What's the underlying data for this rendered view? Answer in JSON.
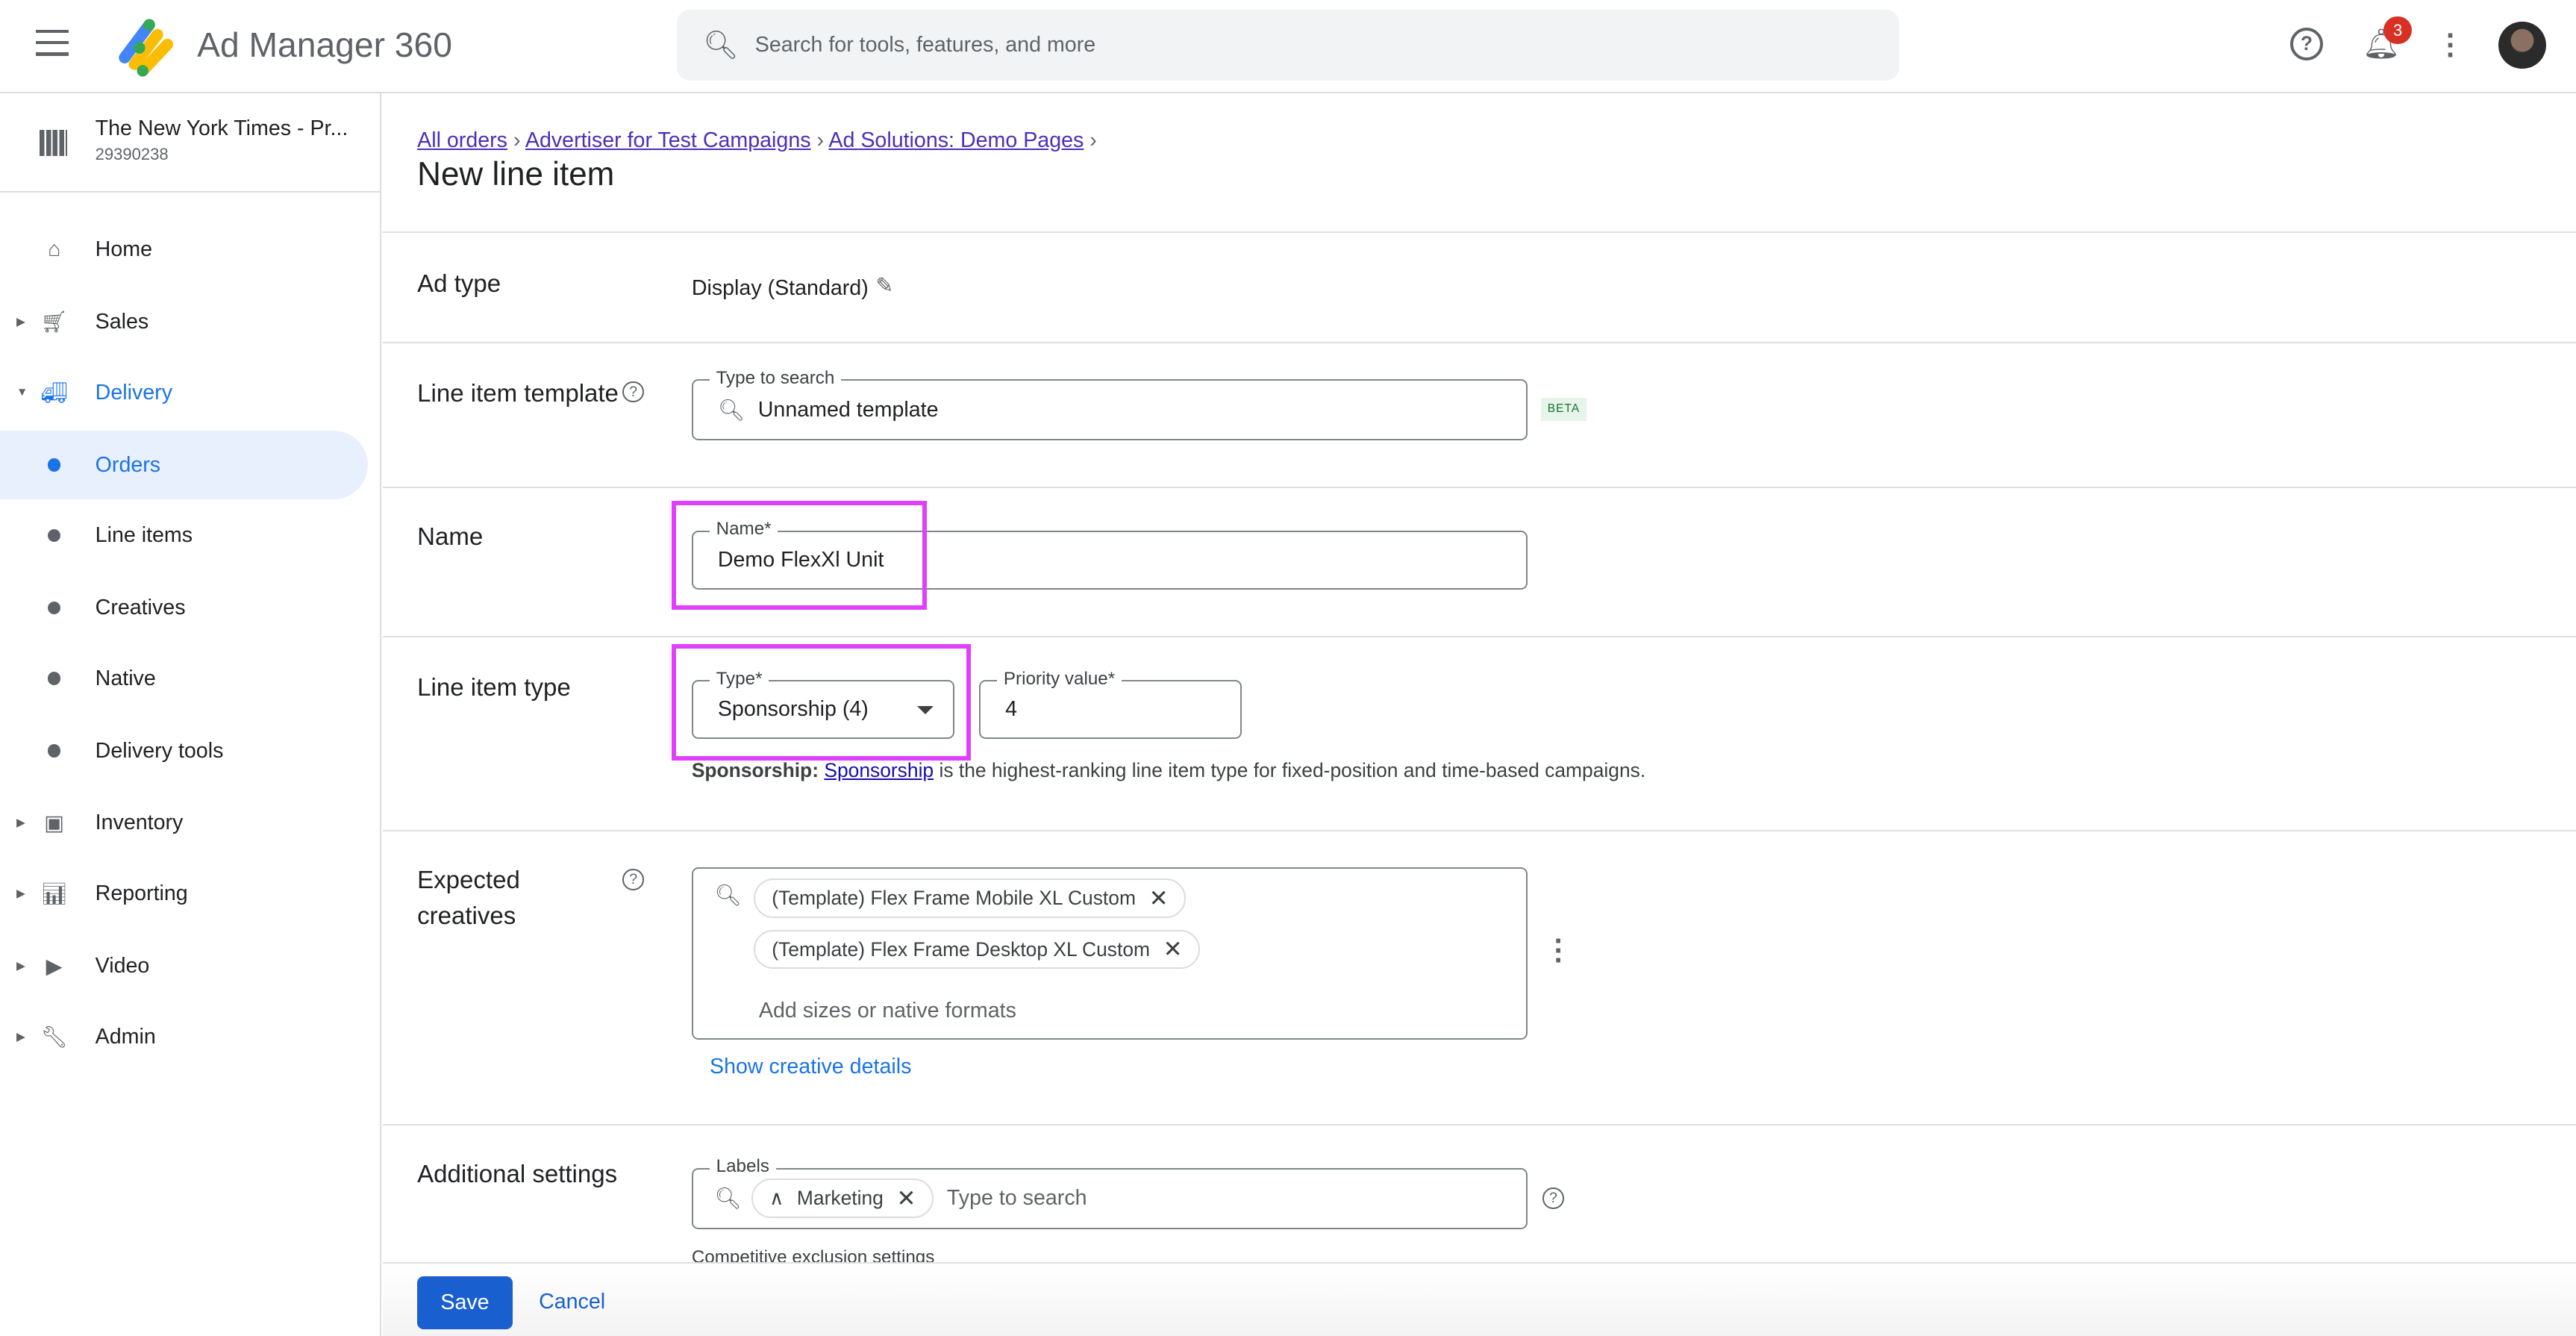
{
  "app": {
    "title": "Ad Manager 360",
    "search_placeholder": "Search for tools, features, and more",
    "notification_count": "3"
  },
  "network": {
    "name": "The New York Times - Pr...",
    "id": "29390238"
  },
  "sidebar": {
    "items": [
      {
        "label": "Home",
        "icon": "home-icon"
      },
      {
        "label": "Sales",
        "icon": "cart-icon"
      },
      {
        "label": "Delivery",
        "icon": "truck-icon"
      },
      {
        "label": "Orders",
        "selected": true
      },
      {
        "label": "Line items"
      },
      {
        "label": "Creatives"
      },
      {
        "label": "Native"
      },
      {
        "label": "Delivery tools"
      },
      {
        "label": "Inventory",
        "icon": "inventory-icon"
      },
      {
        "label": "Reporting",
        "icon": "chart-icon"
      },
      {
        "label": "Video",
        "icon": "video-icon"
      },
      {
        "label": "Admin",
        "icon": "wrench-icon"
      }
    ]
  },
  "breadcrumb": [
    "All orders",
    "Advertiser for Test Campaigns",
    "Ad Solutions: Demo Pages"
  ],
  "page_title": "New line item",
  "form": {
    "ad_type": {
      "label": "Ad type",
      "value": "Display (Standard)"
    },
    "template": {
      "label": "Line item template",
      "field_label": "Type to search",
      "value": "Unnamed template",
      "badge": "BETA"
    },
    "name": {
      "label": "Name",
      "field_label": "Name*",
      "value": "Demo FlexXl Unit"
    },
    "type": {
      "label": "Line item type",
      "field_label": "Type*",
      "value": "Sponsorship (4)",
      "priority_label": "Priority value*",
      "priority_value": "4",
      "help_bold": "Sponsorship:",
      "help_link": "Sponsorship",
      "help_text": "is the highest-ranking line item type for fixed-position and time-based campaigns."
    },
    "creatives": {
      "label_1": "Expected",
      "label_2": "creatives",
      "chips": [
        "(Template) Flex Frame Mobile XL Custom",
        "(Template) Flex Frame Desktop XL Custom"
      ],
      "placeholder": "Add sizes or native formats",
      "details_link": "Show creative details"
    },
    "additional": {
      "label": "Additional settings",
      "labels_field": "Labels",
      "chip": "Marketing",
      "placeholder": "Type to search",
      "competitive": "Competitive exclusion settings"
    }
  },
  "footer": {
    "save": "Save",
    "cancel": "Cancel"
  },
  "colors": {
    "accent": "#1a73e8",
    "highlight": "#e040fb",
    "link": "#4b2fb8"
  }
}
